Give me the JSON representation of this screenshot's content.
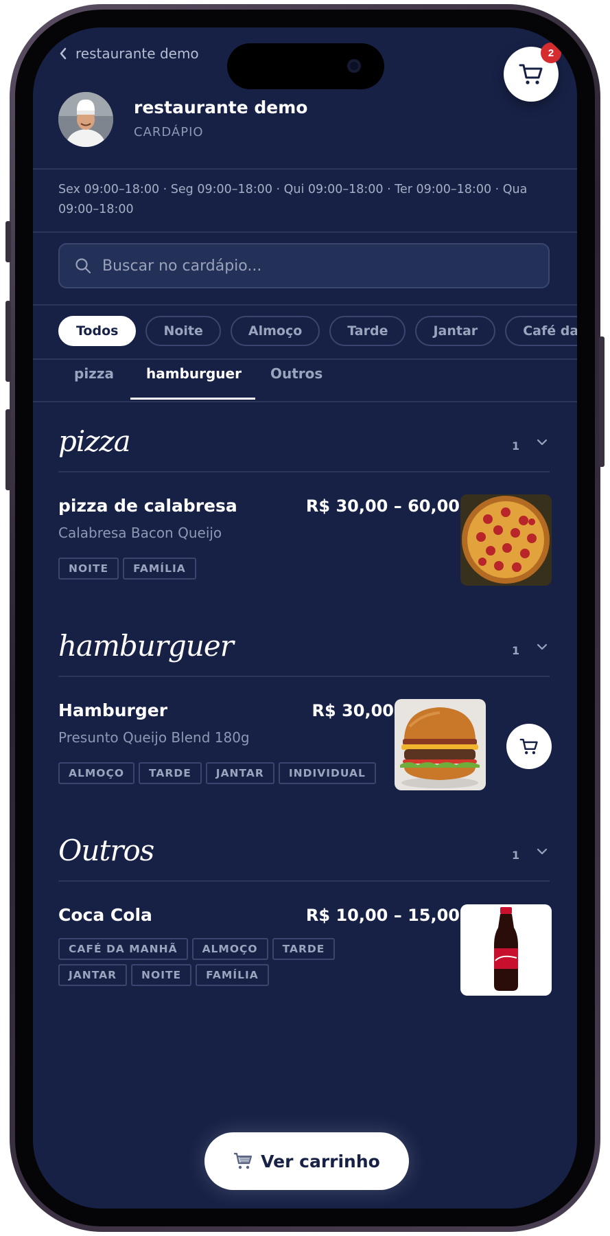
{
  "header": {
    "back_label": "restaurante demo",
    "restaurant_name": "restaurante demo",
    "subtitle": "CARDÁPIO",
    "cart_count": "2"
  },
  "hours": "Sex 09:00–18:00 · Seg 09:00–18:00 · Qui 09:00–18:00 · Ter 09:00–18:00 · Qua 09:00–18:00",
  "search": {
    "placeholder": "Buscar no cardápio..."
  },
  "filters": [
    "Todos",
    "Noite",
    "Almoço",
    "Tarde",
    "Jantar",
    "Café da m"
  ],
  "active_filter": "Todos",
  "tabs": [
    "pizza",
    "hamburguer",
    "Outros"
  ],
  "active_tab": "hamburguer",
  "sections": [
    {
      "title": "pizza",
      "count": "1",
      "item": {
        "name": "pizza de calabresa",
        "price": "R$ 30,00 – 60,00",
        "description": "Calabresa Bacon Queijo",
        "tags": [
          "NOITE",
          "FAMÍLIA"
        ]
      }
    },
    {
      "title": "hamburguer",
      "count": "1",
      "item": {
        "name": "Hamburger",
        "price": "R$ 30,00",
        "description": "Presunto Queijo Blend 180g",
        "tags": [
          "ALMOÇO",
          "TARDE",
          "JANTAR",
          "INDIVIDUAL"
        ]
      }
    },
    {
      "title": "Outros",
      "count": "1",
      "item": {
        "name": "Coca Cola",
        "price": "R$ 10,00 – 15,00",
        "description": "",
        "tags": [
          "CAFÉ DA MANHÃ",
          "ALMOÇO",
          "TARDE",
          "JANTAR",
          "NOITE",
          "FAMÍLIA"
        ]
      }
    }
  ],
  "view_cart_label": "Ver carrinho",
  "colors": {
    "background": "#172146",
    "accent": "#ffffff",
    "badge": "#d52c30"
  }
}
